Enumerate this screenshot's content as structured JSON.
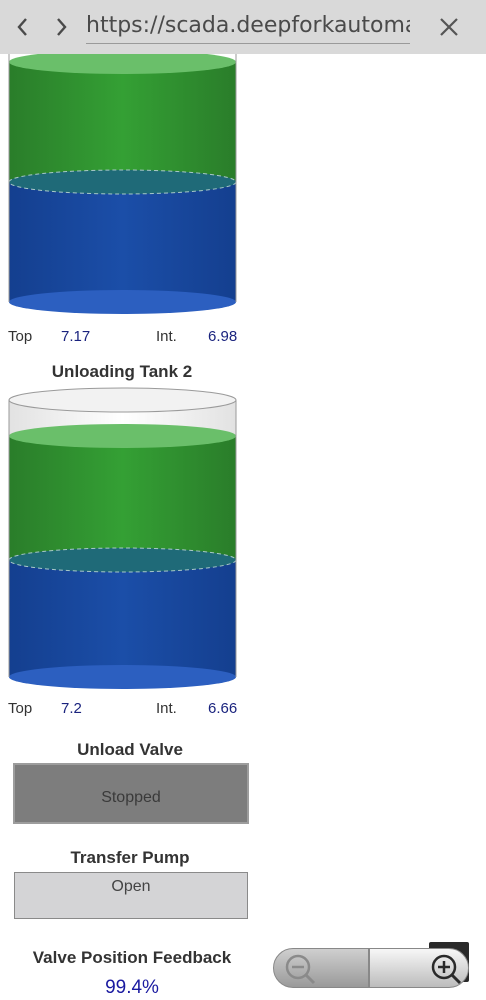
{
  "browser": {
    "url": "https://scada.deepforkautomatic",
    "back_icon": "chevron-left-icon",
    "forward_icon": "chevron-right-icon",
    "close_icon": "close-icon"
  },
  "tank1": {
    "top_label": "Top",
    "top_value": "7.17",
    "int_label": "Int.",
    "int_value": "6.98"
  },
  "tank2": {
    "title": "Unloading Tank 2",
    "top_label": "Top",
    "top_value": "7.2",
    "int_label": "Int.",
    "int_value": "6.66"
  },
  "unload_valve": {
    "title": "Unload Valve",
    "state": "Stopped"
  },
  "transfer_pump": {
    "title": "Transfer Pump",
    "state": "Open"
  },
  "valve_feedback": {
    "title": "Valve Position Feedback",
    "value": "99.4%"
  },
  "zoom": {
    "zoom_out_icon": "zoom-out-icon",
    "zoom_in_icon": "zoom-in-icon"
  },
  "colors": {
    "green_liquid": "#2e8b2e",
    "blue_liquid": "#17479e",
    "value_text": "#1a237e",
    "stopped_bg": "#7d7d7d",
    "open_bg": "#d4d4d6"
  }
}
